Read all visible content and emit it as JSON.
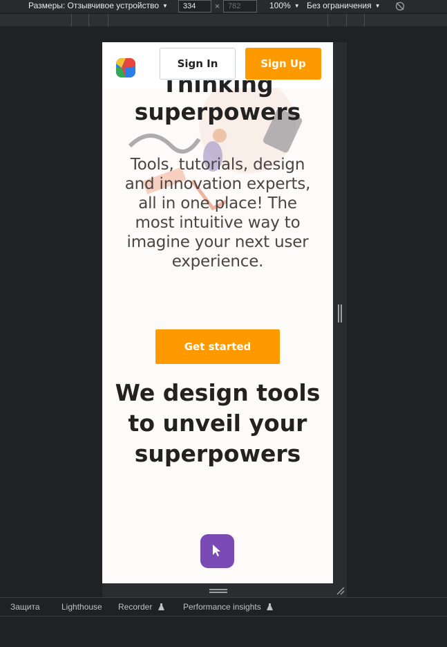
{
  "devtools": {
    "toolbar": {
      "dimensions_label": "Размеры: Отзывчивое устройство",
      "width_value": "334",
      "height_placeholder": "782",
      "times_sign": "×",
      "zoom": "100%",
      "throttling": "Без ограничения",
      "caret": "▼"
    },
    "drawer_tabs": [
      {
        "label": "Защита"
      },
      {
        "label": "Lighthouse"
      },
      {
        "label": "Recorder"
      },
      {
        "label": "Performance insights"
      }
    ]
  },
  "site": {
    "header": {
      "sign_in": "Sign In",
      "sign_up": "Sign Up"
    },
    "hero": {
      "title_line1": "Thinking",
      "title_line2": "superpowers",
      "description": "Tools, tutorials, design and innovation experts, all in one place! The most intuitive way to imagine your next user experience.",
      "cta": "Get started"
    },
    "section": {
      "title": "We design tools to unveil your superpowers"
    }
  },
  "colors": {
    "accent": "#fe9900",
    "fab": "#7a4ab5",
    "page_bg": "#fdfbf9",
    "text": "#222222"
  },
  "icons": {
    "logo": "colorful-cube-logo",
    "fab": "cursor-arrow-icon",
    "rotate": "rotate-icon",
    "flask": "experimental-flask-icon"
  }
}
